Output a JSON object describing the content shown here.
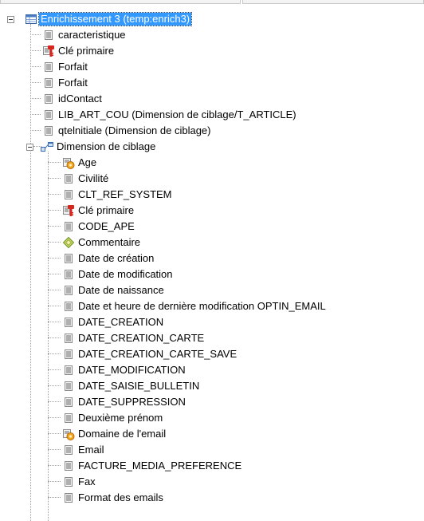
{
  "root": {
    "label": "Enrichissement 3 (temp:enrich3)",
    "icon": "table-icon"
  },
  "root_children": [
    {
      "label": "caracteristique",
      "icon": "field-icon"
    },
    {
      "label": "Clé primaire",
      "icon": "primary-key-icon"
    },
    {
      "label": "Forfait",
      "icon": "field-icon"
    },
    {
      "label": "Forfait",
      "icon": "field-icon"
    },
    {
      "label": "idContact",
      "icon": "field-icon"
    },
    {
      "label": "LIB_ART_COU (Dimension de ciblage/T_ARTICLE)",
      "icon": "field-icon"
    },
    {
      "label": "qtelnitiale (Dimension de ciblage)",
      "icon": "field-icon"
    }
  ],
  "dimension": {
    "label": "Dimension de ciblage",
    "icon": "link-icon"
  },
  "dimension_children": [
    {
      "label": "Age",
      "icon": "computed-field-icon"
    },
    {
      "label": "Civilité",
      "icon": "field-icon"
    },
    {
      "label": "CLT_REF_SYSTEM",
      "icon": "field-icon"
    },
    {
      "label": "Clé primaire",
      "icon": "primary-key-icon"
    },
    {
      "label": "CODE_APE",
      "icon": "field-icon"
    },
    {
      "label": "Commentaire",
      "icon": "diamond-icon"
    },
    {
      "label": "Date de création",
      "icon": "field-icon"
    },
    {
      "label": "Date de modification",
      "icon": "field-icon"
    },
    {
      "label": "Date de naissance",
      "icon": "field-icon"
    },
    {
      "label": "Date et heure de dernière modification OPTIN_EMAIL",
      "icon": "field-icon"
    },
    {
      "label": "DATE_CREATION",
      "icon": "field-icon"
    },
    {
      "label": "DATE_CREATION_CARTE",
      "icon": "field-icon"
    },
    {
      "label": "DATE_CREATION_CARTE_SAVE",
      "icon": "field-icon"
    },
    {
      "label": "DATE_MODIFICATION",
      "icon": "field-icon"
    },
    {
      "label": "DATE_SAISIE_BULLETIN",
      "icon": "field-icon"
    },
    {
      "label": "DATE_SUPPRESSION",
      "icon": "field-icon"
    },
    {
      "label": "Deuxième prénom",
      "icon": "field-icon"
    },
    {
      "label": "Domaine de l'email",
      "icon": "computed-field-icon"
    },
    {
      "label": "Email",
      "icon": "field-icon"
    },
    {
      "label": "FACTURE_MEDIA_PREFERENCE",
      "icon": "field-icon"
    },
    {
      "label": "Fax",
      "icon": "field-icon"
    },
    {
      "label": "Format des emails",
      "icon": "field-icon"
    }
  ],
  "colors": {
    "selection": "#3399ff",
    "connector": "#a0a0a0"
  }
}
